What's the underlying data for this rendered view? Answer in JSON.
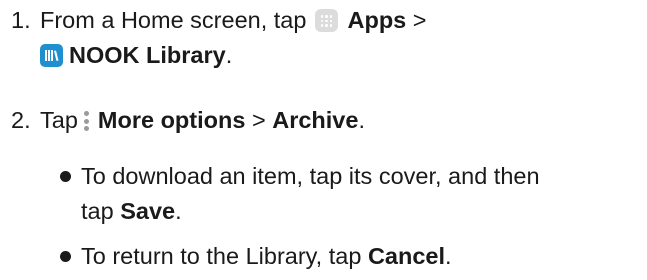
{
  "steps": [
    {
      "number": "1.",
      "line1_prefix": "From a Home screen, tap",
      "apps_label": "Apps",
      "separator": ">",
      "nook_label": "NOOK Library",
      "end": "."
    },
    {
      "number": "2.",
      "prefix": "Tap",
      "more_options_label": "More options",
      "separator": ">",
      "archive_label": "Archive",
      "end": "."
    }
  ],
  "bullets": [
    {
      "line1": "To download an item, tap its cover, and then",
      "line2_prefix": "tap",
      "bold": "Save",
      "end": "."
    },
    {
      "prefix": "To return to the Library, tap",
      "bold": "Cancel",
      "end": "."
    }
  ],
  "icons": {
    "apps": "apps-grid-icon",
    "nook": "nook-library-icon",
    "more": "more-options-icon"
  },
  "colors": {
    "text": "#1a1a1a",
    "apps_icon_bg": "#dcdcdc",
    "nook_icon_bg": "#1f8fd0",
    "more_icon": "#9a9a9a"
  }
}
